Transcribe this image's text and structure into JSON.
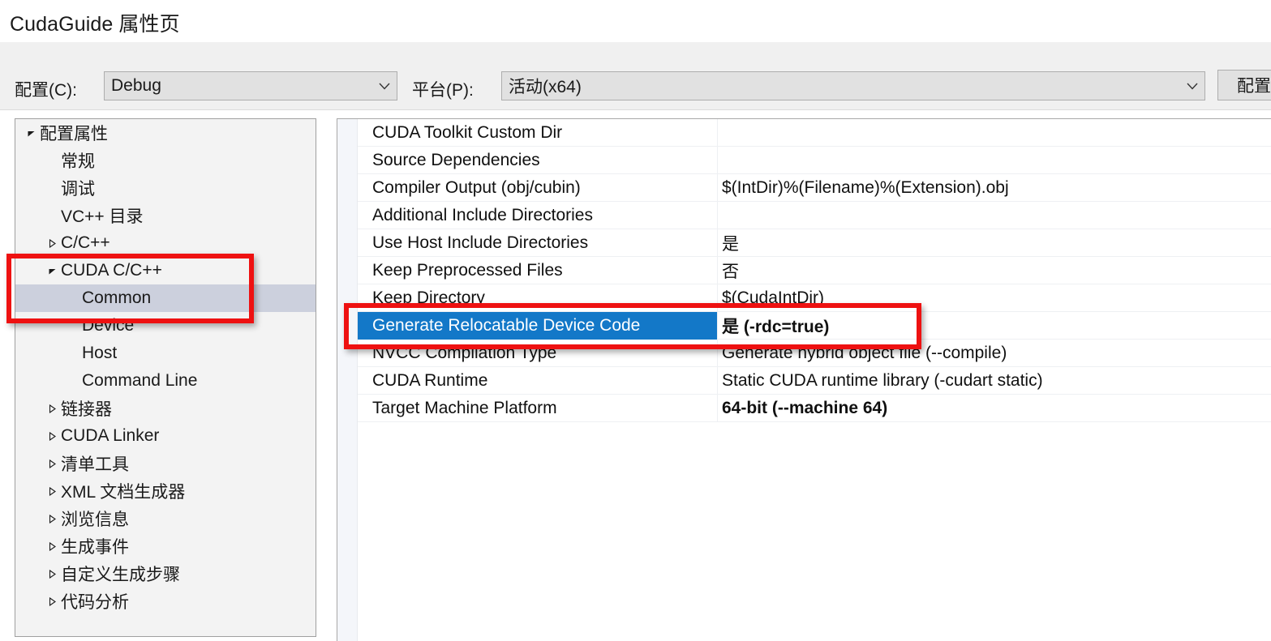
{
  "window": {
    "title": "CudaGuide 属性页"
  },
  "header": {
    "configuration_label": "配置(C):",
    "configuration_value": "Debug",
    "platform_label": "平台(P):",
    "platform_value": "活动(x64)",
    "config_manager_button": "配置"
  },
  "tree": {
    "items": [
      {
        "label": "配置属性",
        "indent": 0,
        "twisty": "expanded",
        "selected": false
      },
      {
        "label": "常规",
        "indent": 1,
        "twisty": "none",
        "selected": false
      },
      {
        "label": "调试",
        "indent": 1,
        "twisty": "none",
        "selected": false
      },
      {
        "label": "VC++ 目录",
        "indent": 1,
        "twisty": "none",
        "selected": false
      },
      {
        "label": "C/C++",
        "indent": 1,
        "twisty": "collapsed",
        "selected": false
      },
      {
        "label": "CUDA C/C++",
        "indent": 1,
        "twisty": "expanded",
        "selected": false
      },
      {
        "label": "Common",
        "indent": 2,
        "twisty": "none",
        "selected": true
      },
      {
        "label": "Device",
        "indent": 2,
        "twisty": "none",
        "selected": false
      },
      {
        "label": "Host",
        "indent": 2,
        "twisty": "none",
        "selected": false
      },
      {
        "label": "Command Line",
        "indent": 2,
        "twisty": "none",
        "selected": false
      },
      {
        "label": "链接器",
        "indent": 1,
        "twisty": "collapsed",
        "selected": false
      },
      {
        "label": "CUDA Linker",
        "indent": 1,
        "twisty": "collapsed",
        "selected": false
      },
      {
        "label": "清单工具",
        "indent": 1,
        "twisty": "collapsed",
        "selected": false
      },
      {
        "label": "XML 文档生成器",
        "indent": 1,
        "twisty": "collapsed",
        "selected": false
      },
      {
        "label": "浏览信息",
        "indent": 1,
        "twisty": "collapsed",
        "selected": false
      },
      {
        "label": "生成事件",
        "indent": 1,
        "twisty": "collapsed",
        "selected": false
      },
      {
        "label": "自定义生成步骤",
        "indent": 1,
        "twisty": "collapsed",
        "selected": false
      },
      {
        "label": "代码分析",
        "indent": 1,
        "twisty": "collapsed",
        "selected": false
      }
    ]
  },
  "grid": {
    "rows": [
      {
        "name": "CUDA Toolkit Custom Dir",
        "value": "",
        "selected": false,
        "bold": false
      },
      {
        "name": "Source Dependencies",
        "value": "",
        "selected": false,
        "bold": false
      },
      {
        "name": "Compiler Output (obj/cubin)",
        "value": "$(IntDir)%(Filename)%(Extension).obj",
        "selected": false,
        "bold": false
      },
      {
        "name": "Additional Include Directories",
        "value": "",
        "selected": false,
        "bold": false
      },
      {
        "name": "Use Host Include Directories",
        "value": "是",
        "selected": false,
        "bold": false
      },
      {
        "name": "Keep Preprocessed Files",
        "value": "否",
        "selected": false,
        "bold": false
      },
      {
        "name": "Keep Directory",
        "value": "$(CudaIntDir)",
        "selected": false,
        "bold": false
      },
      {
        "name": "Generate Relocatable Device Code",
        "value": "是 (-rdc=true)",
        "selected": true,
        "bold": true
      },
      {
        "name": "NVCC Compilation Type",
        "value": "Generate hybrid object file (--compile)",
        "selected": false,
        "bold": false
      },
      {
        "name": "CUDA Runtime",
        "value": "Static CUDA runtime library (-cudart static)",
        "selected": false,
        "bold": false
      },
      {
        "name": "Target Machine Platform",
        "value": "64-bit (--machine 64)",
        "selected": false,
        "bold": true
      }
    ]
  },
  "annotations": {
    "highlight_color": "#ee1111",
    "tree_box": "CUDA C/C++ / Common",
    "grid_box": "Generate Relocatable Device Code = 是 (-rdc=true)"
  },
  "colors": {
    "selection_blue": "#1378c8",
    "tree_selection": "#ccd0dd",
    "annotation_red": "#ee1111"
  }
}
